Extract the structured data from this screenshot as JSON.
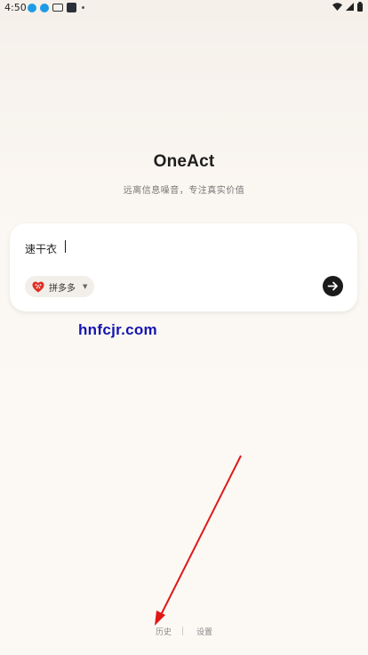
{
  "status_bar": {
    "time": "4:50"
  },
  "app": {
    "title": "OneAct",
    "subtitle": "远离信息噪音，专注真实价值"
  },
  "search": {
    "value": "速干衣",
    "platform_label": "拼多多"
  },
  "watermark": "hnfcjr.com",
  "bottom_nav": {
    "history": "历史",
    "settings": "设置"
  },
  "colors": {
    "accent_dark": "#1b1b1b",
    "pdd_red": "#e02e24",
    "watermark_blue": "#1515b0",
    "annotation_red": "#e01818"
  }
}
